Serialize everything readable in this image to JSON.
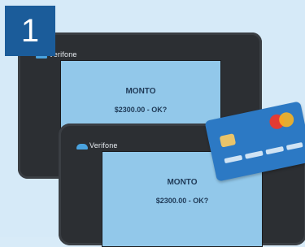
{
  "step": {
    "number": "1"
  },
  "terminals": [
    {
      "brand": "Verifone",
      "screen": {
        "title": "MONTO",
        "amount_line": "$2300.00 - OK?"
      }
    },
    {
      "brand": "Verifone",
      "screen": {
        "title": "MONTO",
        "amount_line": "$2300.00 - OK?"
      }
    }
  ],
  "colors": {
    "background": "#d6eaf8",
    "badge": "#1b5c9a",
    "terminal_body": "#2c2f33",
    "screen": "#92c8ea",
    "card": "#2c79c4"
  },
  "icons": {
    "card": "credit-card-icon",
    "chip": "card-chip-icon",
    "network_logo": "card-network-logo-icon",
    "brand_mark": "verifone-logo-icon"
  }
}
